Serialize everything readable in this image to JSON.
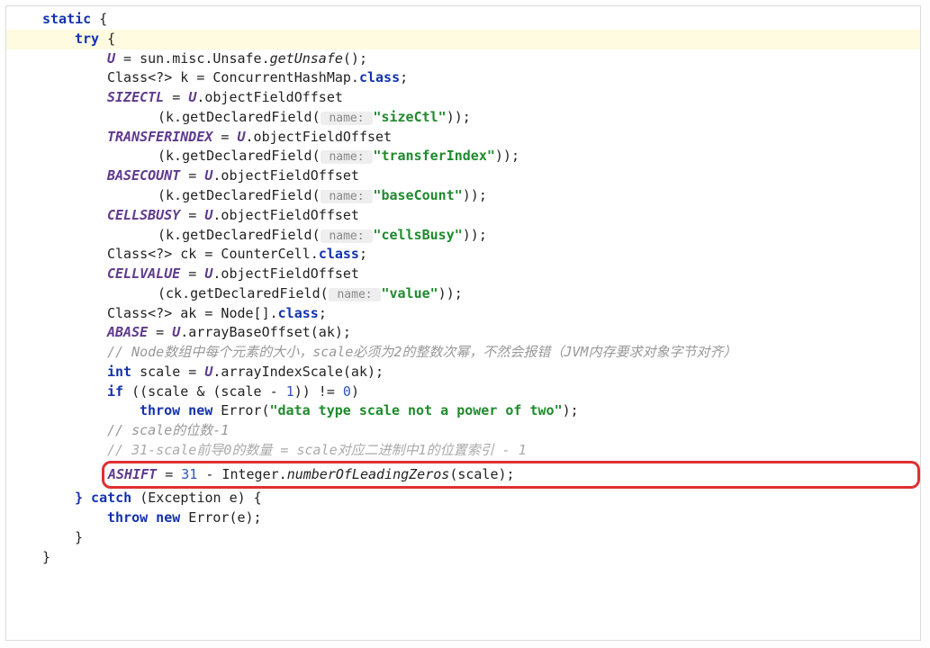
{
  "code": {
    "l1_static": "static",
    "l1_brace": " {",
    "l2_try": "try",
    "l2_brace": " {",
    "l3_a": "U",
    "l3_b": " = sun.misc.Unsafe.",
    "l3_c": "getUnsafe",
    "l3_d": "();",
    "l4": "Class<?> k = ConcurrentHashMap.",
    "l4_class": "class",
    "l4_semi": ";",
    "l5_a": "SIZECTL",
    "l5_b": " = ",
    "l5_c": "U",
    "l5_d": ".objectFieldOffset",
    "l6_a": "(k.getDeclaredField(",
    "l6_hint": " name: ",
    "l6_str": "\"sizeCtl\"",
    "l6_end": "));",
    "l7_a": "TRANSFERINDEX",
    "l7_b": " = ",
    "l7_c": "U",
    "l7_d": ".objectFieldOffset",
    "l8_a": "(k.getDeclaredField(",
    "l8_hint": " name: ",
    "l8_str": "\"transferIndex\"",
    "l8_end": "));",
    "l9_a": "BASECOUNT",
    "l9_b": " = ",
    "l9_c": "U",
    "l9_d": ".objectFieldOffset",
    "l10_a": "(k.getDeclaredField(",
    "l10_hint": " name: ",
    "l10_str": "\"baseCount\"",
    "l10_end": "));",
    "l11_a": "CELLSBUSY",
    "l11_b": " = ",
    "l11_c": "U",
    "l11_d": ".objectFieldOffset",
    "l12_a": "(k.getDeclaredField(",
    "l12_hint": " name: ",
    "l12_str": "\"cellsBusy\"",
    "l12_end": "));",
    "l13": "Class<?> ck = CounterCell.",
    "l13_class": "class",
    "l13_semi": ";",
    "l14_a": "CELLVALUE",
    "l14_b": " = ",
    "l14_c": "U",
    "l14_d": ".objectFieldOffset",
    "l15_a": "(ck.getDeclaredField(",
    "l15_hint": " name: ",
    "l15_str": "\"value\"",
    "l15_end": "));",
    "l16": "Class<?> ak = Node[].",
    "l16_class": "class",
    "l16_semi": ";",
    "l17_a": "ABASE",
    "l17_b": " = ",
    "l17_c": "U",
    "l17_d": ".arrayBaseOffset(ak);",
    "l18": "// Node数组中每个元素的大小，scale必须为2的整数次幂，不然会报错（JVM内存要求对象字节对齐）",
    "l19_int": "int",
    "l19_a": " scale = ",
    "l19_b": "U",
    "l19_c": ".arrayIndexScale(ak);",
    "l20_if": "if",
    "l20_a": " ((scale & (scale - ",
    "l20_num1": "1",
    "l20_b": ")) != ",
    "l20_num0": "0",
    "l20_c": ")",
    "l21_throw": "throw new",
    "l21_a": " Error(",
    "l21_str": "\"data type scale not a power of two\"",
    "l21_b": ");",
    "l22": "// scale的位数-1",
    "l23": "// 31-scale前导0的数量 = scale对应二进制中1的位置索引 - 1",
    "l24_a": "ASHIFT",
    "l24_b": " = ",
    "l24_num": "31",
    "l24_c": " - Integer.",
    "l24_d": "numberOfLeadingZeros",
    "l24_e": "(scale);",
    "l25_brace": "}",
    "l25_catch": " catch ",
    "l25_paren": "(Exception e) {",
    "l26_throw": "throw new",
    "l26_a": " Error(e);",
    "l27": "}",
    "l28": "}"
  }
}
